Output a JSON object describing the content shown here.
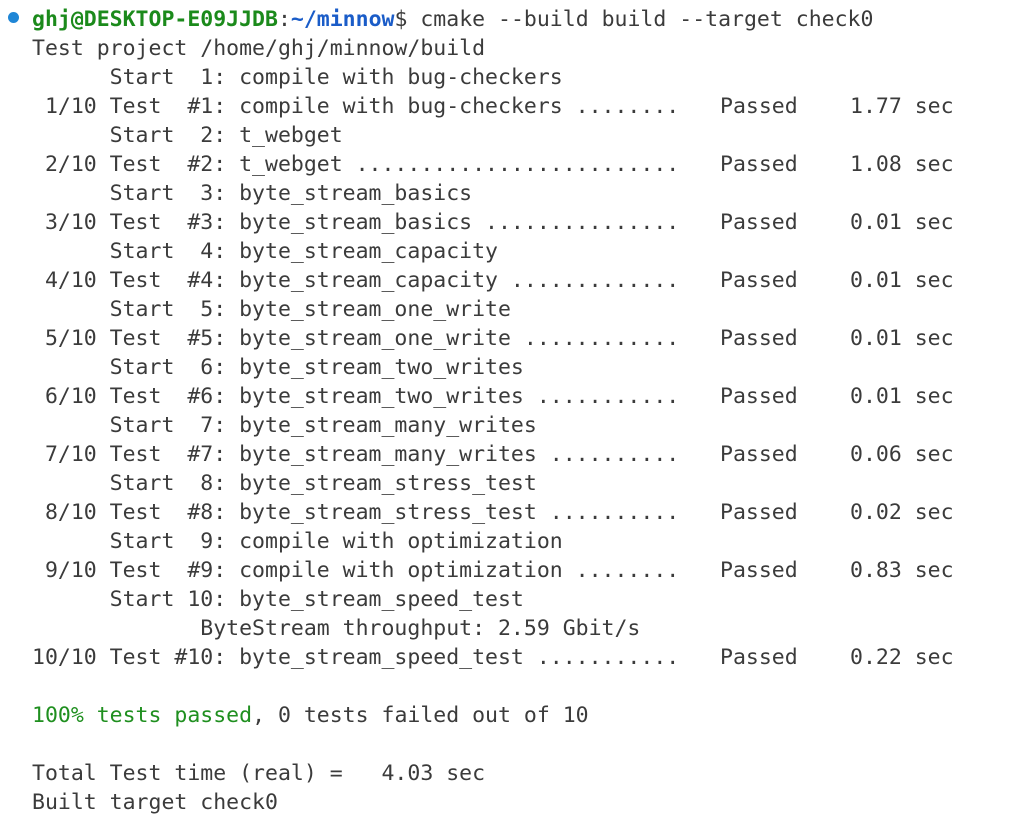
{
  "prompt": {
    "user_host": "ghj@DESKTOP-E09JJDB",
    "sep": ":",
    "path": "~/minnow",
    "symbol": "$",
    "command": " cmake --build build --target check0"
  },
  "test_project": "Test project /home/ghj/minnow/build",
  "tests": [
    {
      "start": "      Start  1: compile with bug-checkers",
      "result": " 1/10 Test  #1: compile with bug-checkers ........",
      "status": "Passed",
      "time": "1.77 sec"
    },
    {
      "start": "      Start  2: t_webget",
      "result": " 2/10 Test  #2: t_webget .........................",
      "status": "Passed",
      "time": "1.08 sec"
    },
    {
      "start": "      Start  3: byte_stream_basics",
      "result": " 3/10 Test  #3: byte_stream_basics ...............",
      "status": "Passed",
      "time": "0.01 sec"
    },
    {
      "start": "      Start  4: byte_stream_capacity",
      "result": " 4/10 Test  #4: byte_stream_capacity .............",
      "status": "Passed",
      "time": "0.01 sec"
    },
    {
      "start": "      Start  5: byte_stream_one_write",
      "result": " 5/10 Test  #5: byte_stream_one_write ............",
      "status": "Passed",
      "time": "0.01 sec"
    },
    {
      "start": "      Start  6: byte_stream_two_writes",
      "result": " 6/10 Test  #6: byte_stream_two_writes ...........",
      "status": "Passed",
      "time": "0.01 sec"
    },
    {
      "start": "      Start  7: byte_stream_many_writes",
      "result": " 7/10 Test  #7: byte_stream_many_writes ..........",
      "status": "Passed",
      "time": "0.06 sec"
    },
    {
      "start": "      Start  8: byte_stream_stress_test",
      "result": " 8/10 Test  #8: byte_stream_stress_test ..........",
      "status": "Passed",
      "time": "0.02 sec"
    },
    {
      "start": "      Start  9: compile with optimization",
      "result": " 9/10 Test  #9: compile with optimization ........",
      "status": "Passed",
      "time": "0.83 sec"
    }
  ],
  "last_test": {
    "start": "      Start 10: byte_stream_speed_test",
    "throughput": "             ByteStream throughput: 2.59 Gbit/s",
    "result": "10/10 Test #10: byte_stream_speed_test ...........",
    "status": "Passed",
    "time": "0.22 sec"
  },
  "summary": {
    "passed_pct": "100% tests passed",
    "rest": ", 0 tests failed out of 10"
  },
  "total_time": "Total Test time (real) =   4.03 sec",
  "built": "Built target check0",
  "colors": {
    "text": "#3b3b3b",
    "user_host": "#1b8a1b",
    "path": "#1a5cc8",
    "success": "#1f8f1f",
    "bullet": "#1f86d6"
  }
}
